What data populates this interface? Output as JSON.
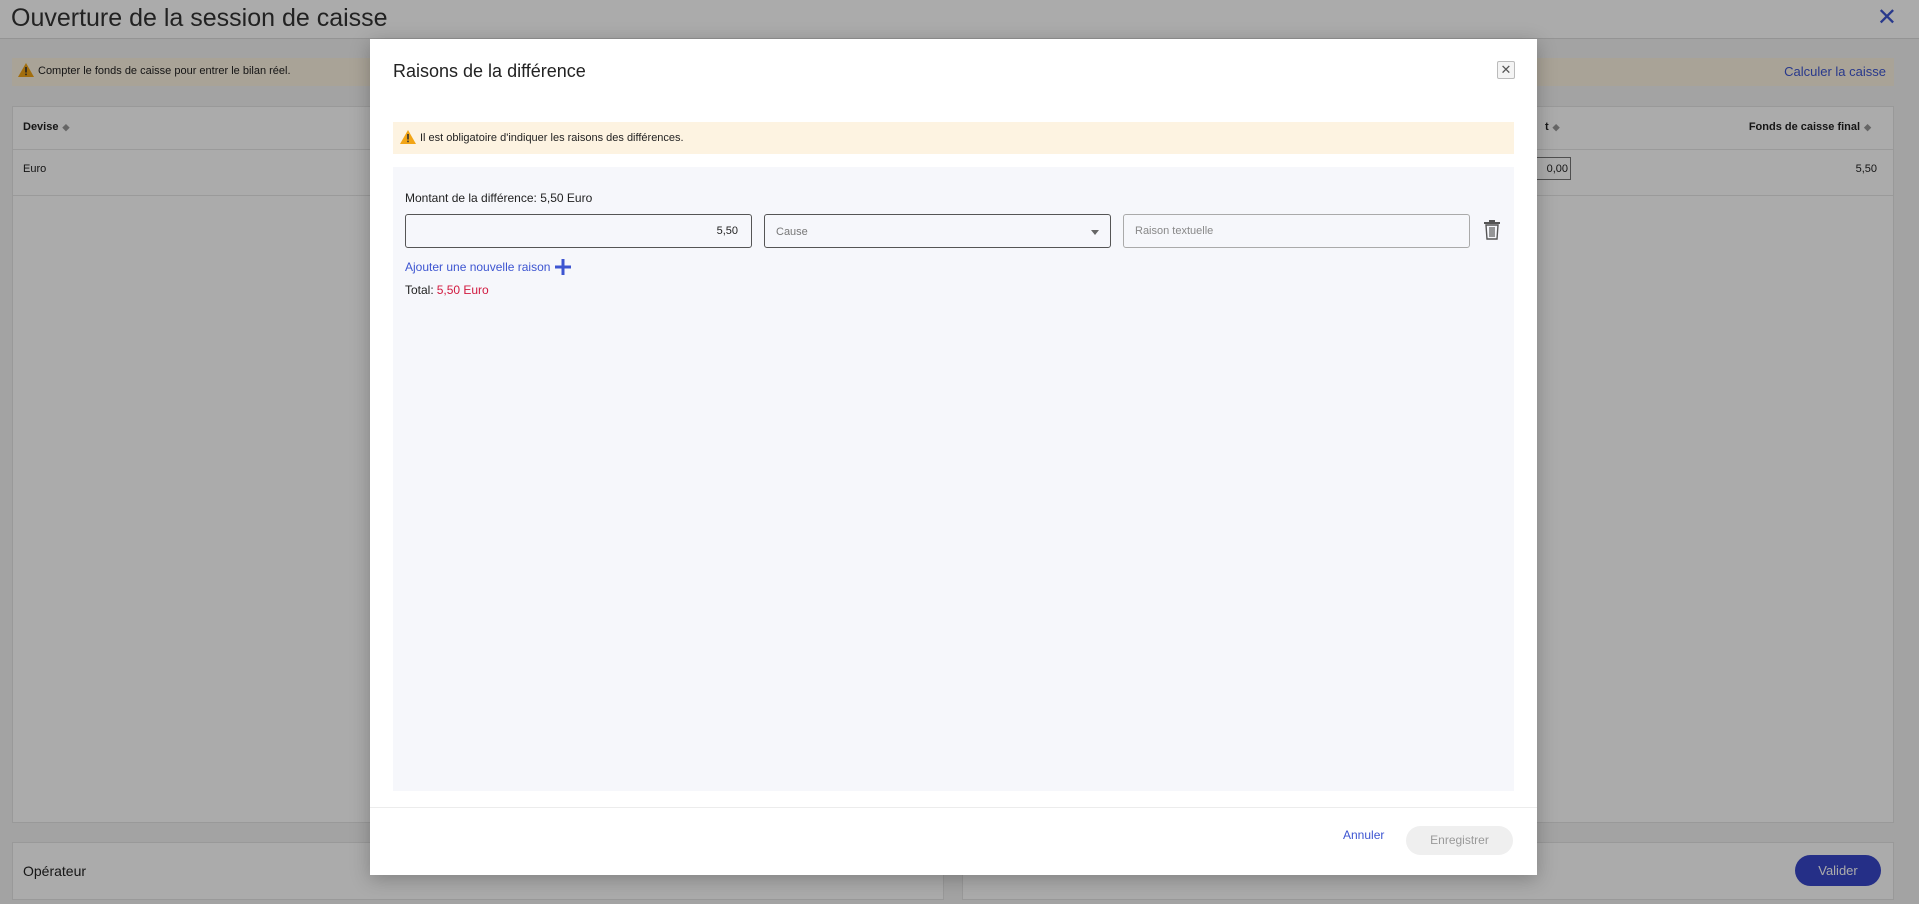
{
  "page": {
    "title": "Ouverture de la session de caisse",
    "warning": "Compter le fonds de caisse pour entrer le bilan réel.",
    "calc_link": "Calculer la caisse",
    "table": {
      "col_devise": "Devise",
      "col_partial": "t",
      "col_final": "Fonds de caisse final",
      "row": {
        "devise": "Euro",
        "partial_value": "0,00",
        "final": "5,50"
      }
    },
    "bottom": {
      "operator_label": "Opérateur",
      "validate_label": "Valider"
    }
  },
  "modal": {
    "title": "Raisons de la différence",
    "warning": "Il est obligatoire d'indiquer les raisons des différences.",
    "difference_label": "Montant de la différence: 5,50 Euro",
    "amount_value": "5,50",
    "cause_placeholder": "Cause",
    "reason_placeholder": "Raison textuelle",
    "add_reason": "Ajouter une nouvelle raison",
    "total_label": "Total:",
    "total_value": "5,50 Euro",
    "cancel_label": "Annuler",
    "save_label": "Enregistrer"
  },
  "colors": {
    "accent": "#3d55d1",
    "primary_button": "#3846c9",
    "total_negative": "#d11a3f",
    "warning_bg": "#fdf3e1",
    "warning_icon": "#f2a516"
  }
}
